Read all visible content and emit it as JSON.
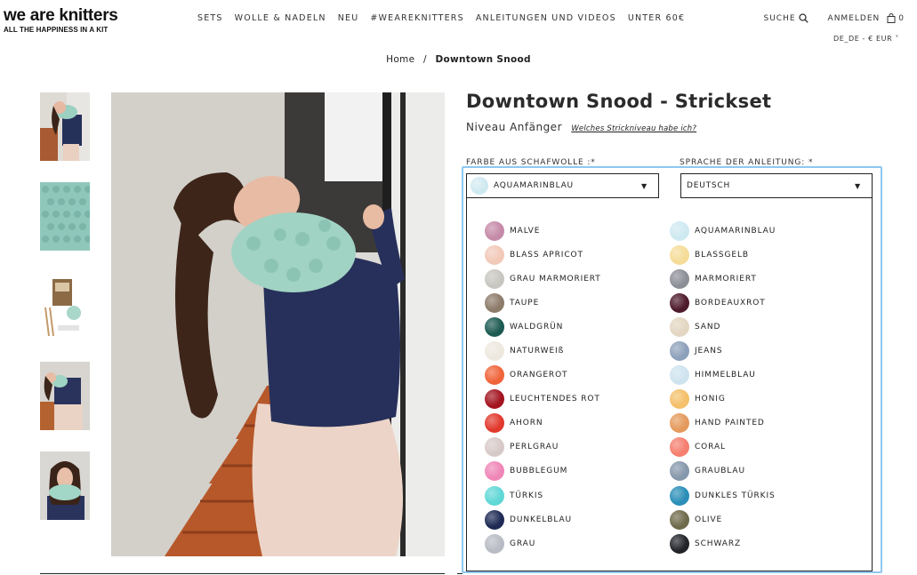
{
  "brand": {
    "name": "we are knitters",
    "tagline": "ALL THE HAPPINESS IN A KIT"
  },
  "nav": [
    "SETS",
    "WOLLE & NADELN",
    "NEU",
    "#WEAREKNITTERS",
    "ANLEITUNGEN UND VIDEOS",
    "UNTER 60€"
  ],
  "util": {
    "search": "SUCHE",
    "login": "ANMELDEN",
    "cart_count": "0",
    "locale": "DE_DE - € EUR"
  },
  "breadcrumb": {
    "home": "Home",
    "separator": "/",
    "current": "Downtown Snood"
  },
  "product": {
    "title": "Downtown Snood - Strickset",
    "level": "Niveau Anfänger",
    "level_link": "Welches Strickniveau habe ich?"
  },
  "color_select": {
    "label": "FARBE AUS SCHAFWOLLE :*",
    "value": "AQUAMARINBLAU",
    "swatch": "#cfe9f1"
  },
  "language_select": {
    "label": "SPRACHE DER ANLEITUNG: *",
    "value": "DEUTSCH"
  },
  "colors_left": [
    {
      "name": "MALVE",
      "color": "#c58aa8"
    },
    {
      "name": "BLASS APRICOT",
      "color": "#f2c9b8"
    },
    {
      "name": "GRAU MARMORIERT",
      "color": "#c8c6c0"
    },
    {
      "name": "TAUPE",
      "color": "#8d7b6a"
    },
    {
      "name": "WALDGRÜN",
      "color": "#1c5a52"
    },
    {
      "name": "NATURWEIß",
      "color": "#ede9df"
    },
    {
      "name": "ORANGEROT",
      "color": "#f0643a"
    },
    {
      "name": "LEUCHTENDES ROT",
      "color": "#a3141f"
    },
    {
      "name": "AHORN",
      "color": "#e2392d"
    },
    {
      "name": "PERLGRAU",
      "color": "#d8c9c9"
    },
    {
      "name": "BUBBLEGUM",
      "color": "#ef86b7"
    },
    {
      "name": "TÜRKIS",
      "color": "#5fd7d6"
    },
    {
      "name": "DUNKELBLAU",
      "color": "#1e2a55"
    },
    {
      "name": "GRAU",
      "color": "#b9bcc4"
    }
  ],
  "colors_right": [
    {
      "name": "AQUAMARINBLAU",
      "color": "#cfe9f1"
    },
    {
      "name": "BLASSGELB",
      "color": "#f5dc98"
    },
    {
      "name": "MARMORIERT",
      "color": "#8d8f97"
    },
    {
      "name": "BORDEAUXROT",
      "color": "#4e1a2c"
    },
    {
      "name": "SAND",
      "color": "#e3d6c2"
    },
    {
      "name": "JEANS",
      "color": "#8ea1bb"
    },
    {
      "name": "HIMMELBLAU",
      "color": "#cfe3ef"
    },
    {
      "name": "HONIG",
      "color": "#f4c06a"
    },
    {
      "name": "HAND PAINTED",
      "color": "#e59a5c"
    },
    {
      "name": "CORAL",
      "color": "#f57f6f"
    },
    {
      "name": "GRAUBLAU",
      "color": "#8698ab"
    },
    {
      "name": "DUNKLES TÜRKIS",
      "color": "#2b8fb8"
    },
    {
      "name": "OLIVE",
      "color": "#6e6a4c"
    },
    {
      "name": "SCHWARZ",
      "color": "#23242a"
    }
  ]
}
